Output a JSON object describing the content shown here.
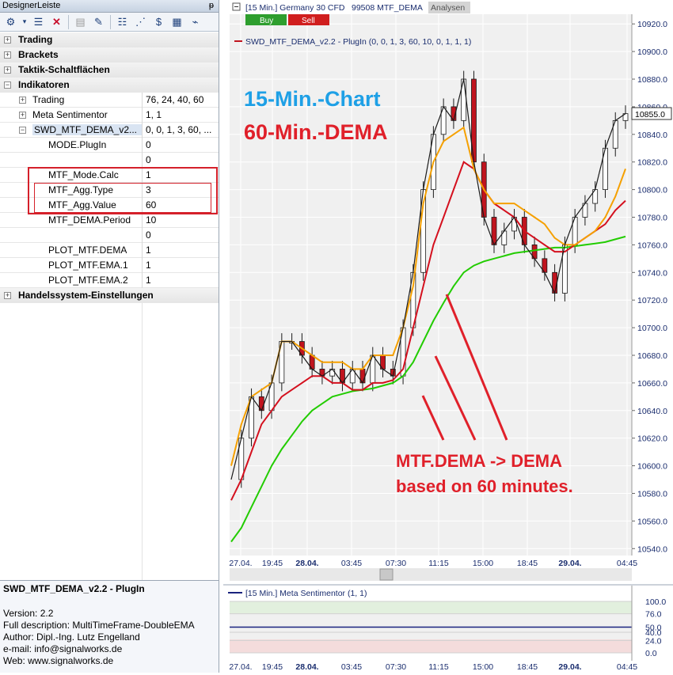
{
  "panel": {
    "title": "DesignerLeiste",
    "pin_glyph": "ᵽ",
    "categories": {
      "trading": "Trading",
      "brackets": "Brackets",
      "taktik": "Taktik-Schaltflächen",
      "indikatoren": "Indikatoren",
      "handelssystem": "Handelssystem-Einstellungen"
    },
    "indicators": [
      {
        "label": "Trading",
        "value": "76, 24, 40, 60"
      },
      {
        "label": "Meta Sentimentor",
        "value": "1, 1"
      },
      {
        "label": "SWD_MTF_DEMA_v2...",
        "value": "0, 0, 1, 3, 60, ..."
      }
    ],
    "params": [
      {
        "label": "MODE.PlugIn",
        "value": "0"
      },
      {
        "label": "",
        "value": "0"
      },
      {
        "label": "MTF_Mode.Calc",
        "value": "1"
      },
      {
        "label": "MTF_Agg.Type",
        "value": "3"
      },
      {
        "label": "MTF_Agg.Value",
        "value": "60"
      },
      {
        "label": "MTF_DEMA.Period",
        "value": "10"
      },
      {
        "label": "",
        "value": "0"
      },
      {
        "label": "PLOT_MTF.DEMA",
        "value": "1"
      },
      {
        "label": "PLOT_MTF.EMA.1",
        "value": "1"
      },
      {
        "label": "PLOT_MTF.EMA.2",
        "value": "1"
      }
    ]
  },
  "info": {
    "title": "SWD_MTF_DEMA_v2.2 - PlugIn",
    "version": "Version: 2.2",
    "description": "Full description: MultiTimeFrame-DoubleEMA",
    "author": "Author: Dipl.-Ing. Lutz Engelland",
    "email": "e-mail: info@signalworks.de",
    "web": "Web: www.signalworks.de"
  },
  "chart": {
    "header": "[15 Min.] Germany 30 CFD",
    "header_id": "99508 MTF_DEMA",
    "analysen_button": "Analysen",
    "buy_button": "Buy",
    "sell_button": "Sell",
    "indicator_legend": "SWD_MTF_DEMA_v2.2 - PlugIn  (0, 0, 1, 3, 60, 10, 0, 1, 1, 1)",
    "annotation_1": "15-Min.-Chart",
    "annotation_2": "60-Min.-DEMA",
    "annotation_3": "MTF.DEMA -> DEMA",
    "annotation_4": "based on 60 minutes.",
    "price_badge": "10855.0",
    "colors": {
      "candle_up": "#ffffff",
      "candle_down": "#c0141e",
      "ema1": "#f5a000",
      "dema": "#d4101e",
      "ema2": "#22cc00",
      "annot_blue": "#1ea0e6",
      "annot_red": "#e0202a"
    },
    "sentimentor_legend": "[15 Min.] Meta Sentimentor  (1, 1)"
  },
  "chart_data": [
    {
      "type": "line",
      "title": "",
      "y_ticks": [
        10540,
        10560,
        10580,
        10600,
        10620,
        10640,
        10660,
        10680,
        10700,
        10720,
        10740,
        10760,
        10780,
        10800,
        10820,
        10840,
        10860,
        10880,
        10900,
        10920
      ],
      "ylim": [
        10535,
        10927
      ],
      "x_ticks": [
        "27.04.",
        "19:45",
        "28.04.",
        "03:45",
        "07:30",
        "11:15",
        "15:00",
        "18:45",
        "29.04.",
        "04:45"
      ],
      "last_price": 10855.0,
      "series": [
        {
          "name": "",
          "values": [
            10590,
            10620,
            10650,
            10640,
            10660,
            10690,
            10690,
            10680,
            10670,
            10665,
            10670,
            10660,
            10670,
            10660,
            10680,
            10670,
            10665,
            10700,
            10740,
            10800,
            10840,
            10860,
            10850,
            10880,
            10820,
            10780,
            10760,
            10770,
            10780,
            10760,
            10750,
            10740,
            10725,
            10760,
            10780,
            10790,
            10800,
            10830,
            10850,
            10855
          ]
        },
        {
          "name": "",
          "values": [
            10600,
            10630,
            10650,
            10655,
            10660,
            10690,
            10690,
            10685,
            10680,
            10675,
            10675,
            10675,
            10670,
            10670,
            10680,
            10680,
            10680,
            10700,
            10730,
            10790,
            10820,
            10835,
            10840,
            10845,
            10815,
            10800,
            10790,
            10790,
            10790,
            10785,
            10780,
            10775,
            10765,
            10760,
            10760,
            10765,
            10770,
            10780,
            10795,
            10815
          ]
        },
        {
          "name": "",
          "values": [
            10575,
            10590,
            10610,
            10630,
            10640,
            10650,
            10655,
            10660,
            10665,
            10665,
            10660,
            10660,
            10655,
            10655,
            10660,
            10660,
            10662,
            10670,
            10700,
            10730,
            10760,
            10780,
            10800,
            10820,
            10815,
            10800,
            10790,
            10785,
            10780,
            10770,
            10765,
            10760,
            10755,
            10755,
            10760,
            10765,
            10770,
            10775,
            10785,
            10792
          ]
        },
        {
          "name": "",
          "values": [
            10545,
            10555,
            10570,
            10585,
            10600,
            10612,
            10622,
            10632,
            10640,
            10645,
            10650,
            10652,
            10654,
            10655,
            10656,
            10658,
            10660,
            10665,
            10675,
            10690,
            10705,
            10718,
            10730,
            10740,
            10745,
            10748,
            10750,
            10752,
            10754,
            10755,
            10756,
            10757,
            10758,
            10758,
            10759,
            10760,
            10761,
            10762,
            10764,
            10766
          ]
        }
      ]
    },
    {
      "type": "line",
      "title": "",
      "y_ticks": [
        0.0,
        24.0,
        40.0,
        50.0,
        76.0,
        100.0
      ],
      "ylim": [
        0,
        100
      ],
      "x_ticks": [
        "27.04.",
        "19:45",
        "28.04.",
        "03:45",
        "07:30",
        "11:15",
        "15:00",
        "18:45",
        "29.04.",
        "04:45"
      ],
      "series": [
        {
          "name": "",
          "values": [
            50,
            50
          ]
        }
      ]
    }
  ]
}
